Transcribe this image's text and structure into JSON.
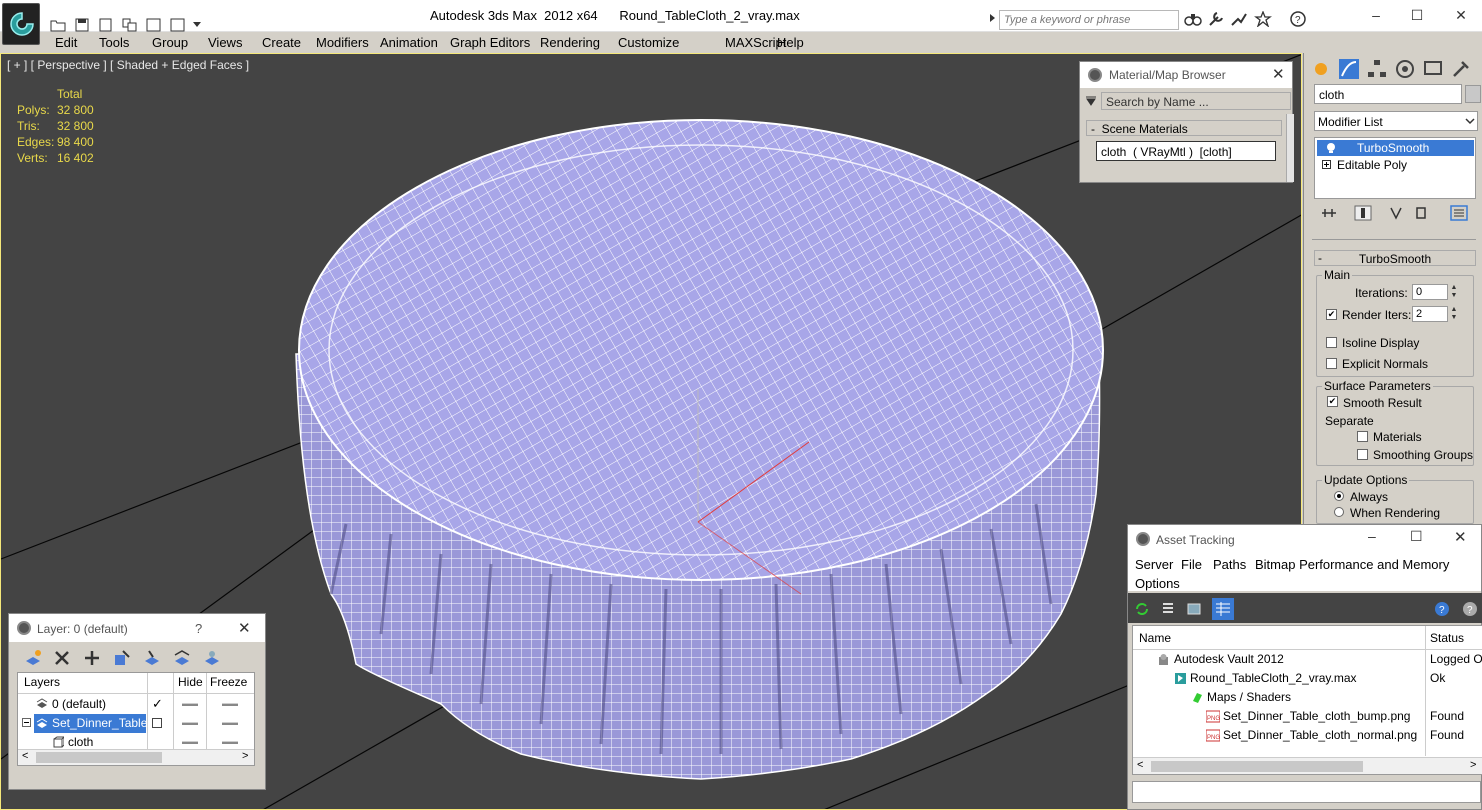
{
  "titlebar": {
    "app": "Autodesk 3ds Max  2012 x64",
    "file": "Round_TableCloth_2_vray.max",
    "search_placeholder": "Type a keyword or phrase"
  },
  "menu": [
    "Edit",
    "Tools",
    "Group",
    "Views",
    "Create",
    "Modifiers",
    "Animation",
    "Graph Editors",
    "Rendering",
    "Customize",
    "MAXScript",
    "Help"
  ],
  "viewport": {
    "label": "[ + ] [ Perspective ] [ Shaded + Edged Faces ]",
    "stats_header": "Total",
    "stats": [
      {
        "label": "Polys:",
        "value": "32 800"
      },
      {
        "label": "Tris:",
        "value": "32 800"
      },
      {
        "label": "Edges:",
        "value": "98 400"
      },
      {
        "label": "Verts:",
        "value": "16 402"
      }
    ]
  },
  "command_panel": {
    "object_name": "cloth",
    "modifier_list": "Modifier List",
    "stack": [
      "TurboSmooth",
      "Editable Poly"
    ],
    "rollout": "TurboSmooth",
    "main_group": "Main",
    "iterations_label": "Iterations:",
    "iterations_value": "0",
    "render_iters_label": "Render Iters:",
    "render_iters_value": "2",
    "isoline": "Isoline Display",
    "explicit_normals": "Explicit Normals",
    "surface_group": "Surface Parameters",
    "smooth_result": "Smooth Result",
    "separate": "Separate",
    "materials": "Materials",
    "smoothing_groups": "Smoothing Groups",
    "update_group": "Update Options",
    "always": "Always",
    "when_rendering": "When Rendering"
  },
  "material_browser": {
    "title": "Material/Map Browser",
    "search": "Search by Name ...",
    "section": "Scene Materials",
    "item": "cloth  ( VRayMtl )  [cloth]"
  },
  "layer_window": {
    "title": "Layer: 0 (default)",
    "help": "?",
    "columns": [
      "Layers",
      "Hide",
      "Freeze"
    ],
    "rows": [
      "0 (default)",
      "Set_Dinner_Table",
      "cloth"
    ]
  },
  "asset_tracking": {
    "title": "Asset Tracking",
    "menu": [
      "Server",
      "File",
      "Paths",
      "Bitmap Performance and Memory",
      "Options"
    ],
    "columns": [
      "Name",
      "Status"
    ],
    "rows": [
      {
        "name": "Autodesk Vault 2012",
        "status": "Logged O"
      },
      {
        "name": "Round_TableCloth_2_vray.max",
        "status": "Ok"
      },
      {
        "name": "Maps / Shaders",
        "status": ""
      },
      {
        "name": "Set_Dinner_Table_cloth_bump.png",
        "status": "Found"
      },
      {
        "name": "Set_Dinner_Table_cloth_normal.png",
        "status": "Found"
      }
    ]
  },
  "colors": {
    "viewport_bg": "#444444",
    "stats_text": "#e8d84a",
    "cloth_fill": "#a8a6e8",
    "wire": "#ffffff",
    "selection": "#3a7ad4"
  }
}
